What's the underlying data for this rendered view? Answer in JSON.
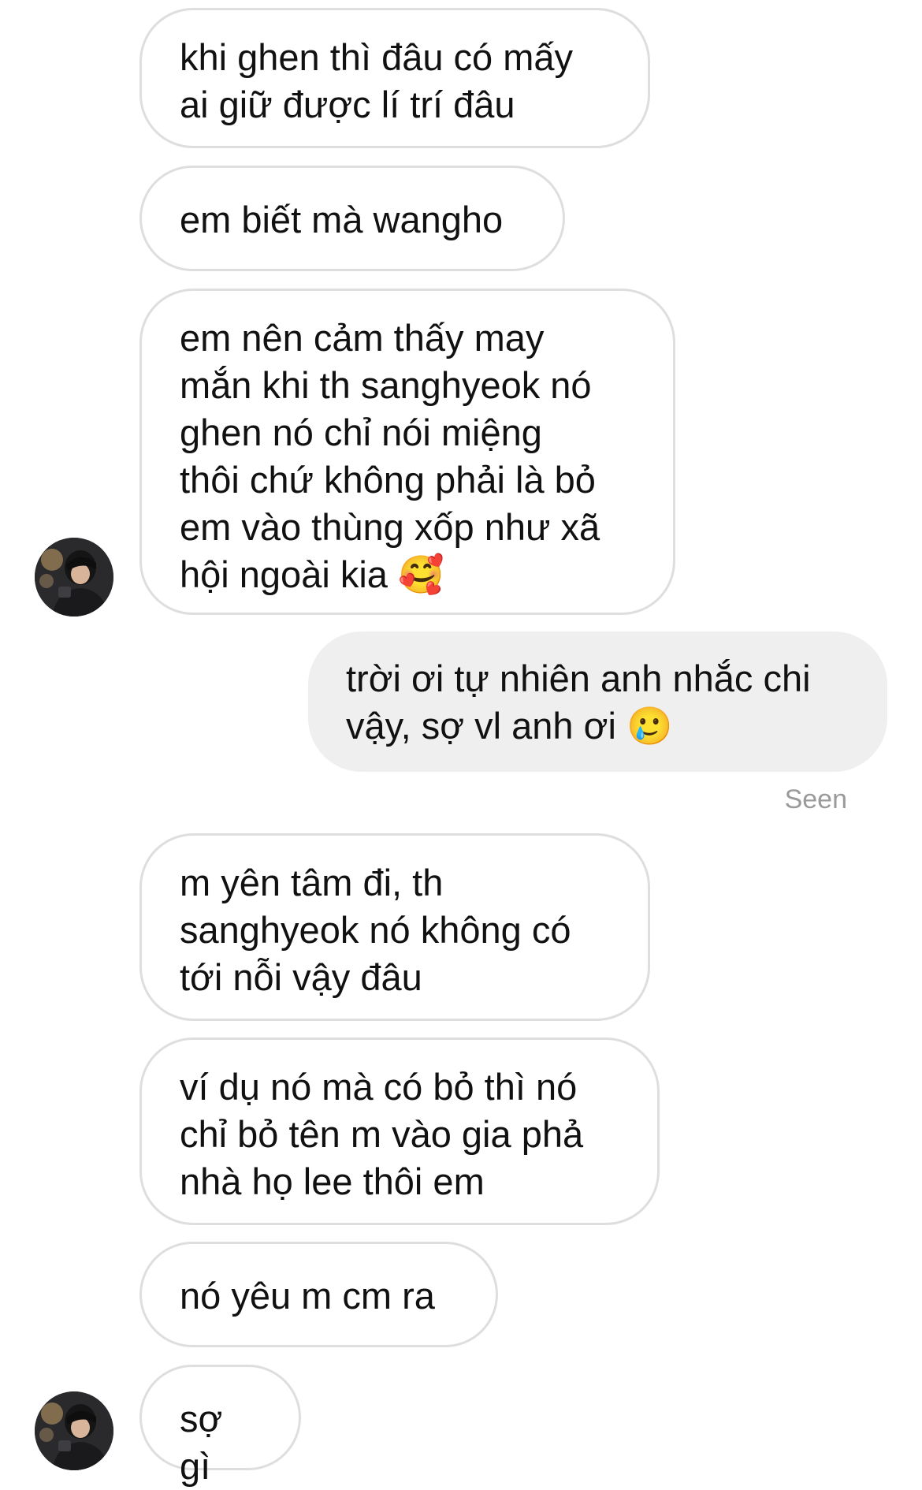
{
  "conversation": {
    "messages": [
      {
        "sender": "other",
        "text": "khi ghen thì đâu có mấy\nai giữ được lí trí đâu"
      },
      {
        "sender": "other",
        "text": "em biết mà wangho"
      },
      {
        "sender": "other",
        "text": "em nên cảm thấy may\nmắn khi th sanghyeok nó\nghen nó chỉ nói miệng\nthôi chứ không phải là bỏ\nem vào thùng xốp như xã\nhội ngoài kia 🥰"
      },
      {
        "sender": "me",
        "text": "trời ơi tự nhiên anh nhắc chi\nvậy, sợ vl anh ơi 🥲"
      },
      {
        "sender": "other",
        "text": "m yên tâm đi, th\nsanghyeok nó không có\ntới nỗi vậy đâu"
      },
      {
        "sender": "other",
        "text": "ví dụ nó mà có bỏ thì nó\nchỉ bỏ tên m vào gia phả\nnhà họ lee thôi em"
      },
      {
        "sender": "other",
        "text": "nó yêu m cm ra"
      },
      {
        "sender": "other",
        "text": "sợ gì"
      }
    ],
    "seen_label": "Seen"
  },
  "colors": {
    "incoming_border": "#dedede",
    "incoming_bg": "#ffffff",
    "outgoing_bg": "#efefef",
    "seen_text": "#9a9a9a",
    "text": "#111111"
  },
  "icons": {
    "avatar": "contact-avatar-photo"
  }
}
